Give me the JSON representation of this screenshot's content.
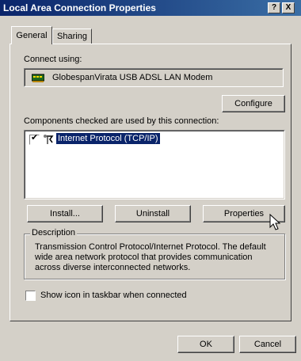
{
  "window": {
    "title": "Local Area Connection Properties",
    "help_button": "?",
    "close_button": "X"
  },
  "tabs": [
    {
      "label": "General",
      "selected": true
    },
    {
      "label": "Sharing",
      "selected": false
    }
  ],
  "general": {
    "connect_using_label": "Connect using:",
    "adapter_name": "GlobespanVirata USB ADSL LAN Modem",
    "configure_button": "Configure",
    "components_label": "Components checked are used by this connection:",
    "components": [
      {
        "name": "Internet Protocol (TCP/IP)",
        "checked": true,
        "selected": true
      }
    ],
    "install_button": "Install...",
    "uninstall_button": "Uninstall",
    "properties_button": "Properties",
    "description_title": "Description",
    "description_text": "Transmission Control Protocol/Internet Protocol. The default wide area network protocol that provides communication across diverse interconnected networks.",
    "show_icon_label": "Show icon in taskbar when connected",
    "show_icon_checked": false
  },
  "footer": {
    "ok_button": "OK",
    "cancel_button": "Cancel"
  },
  "colors": {
    "title_gradient_start": "#0a246a",
    "title_gradient_end": "#3a6ea5",
    "selection": "#0a246a",
    "face": "#d4d0c8"
  },
  "icons": {
    "adapter": "network-adapter-icon",
    "protocol": "protocol-icon",
    "cursor": "mouse-pointer-icon"
  }
}
